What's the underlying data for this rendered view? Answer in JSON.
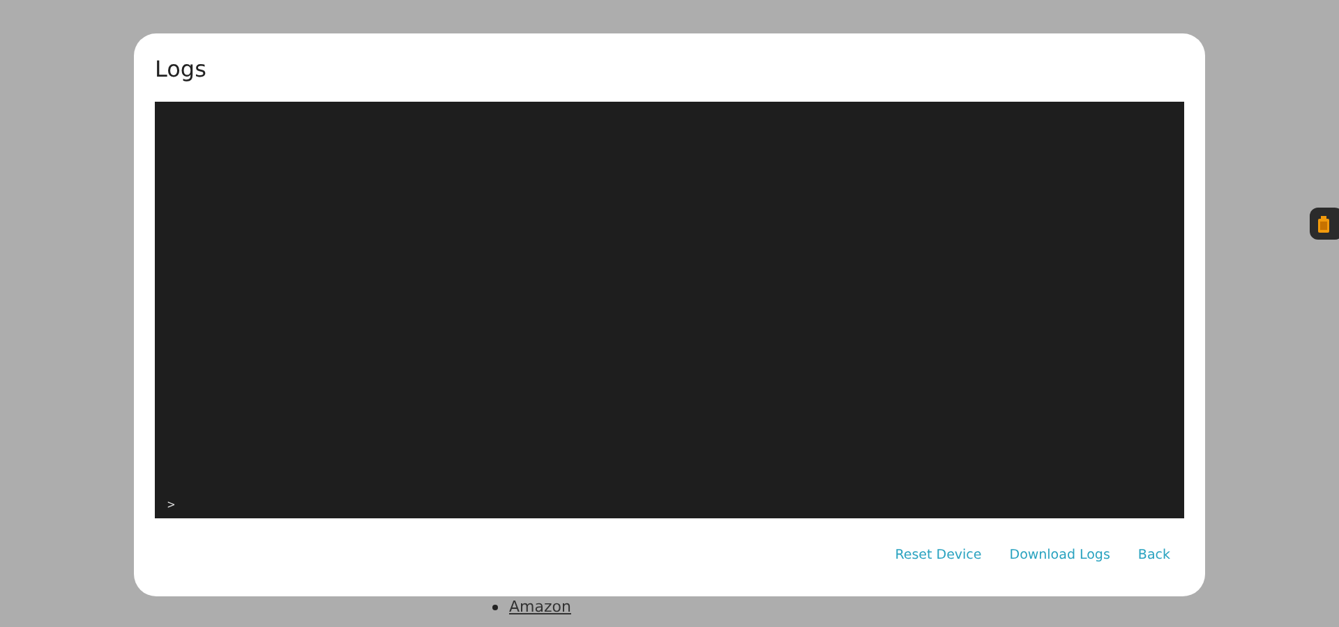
{
  "page": {
    "list_items": [
      "Amazon"
    ]
  },
  "dialog": {
    "title": "Logs",
    "console": {
      "prompt": ">"
    },
    "buttons": [
      "Reset Device",
      "Download Logs",
      "Back"
    ]
  }
}
